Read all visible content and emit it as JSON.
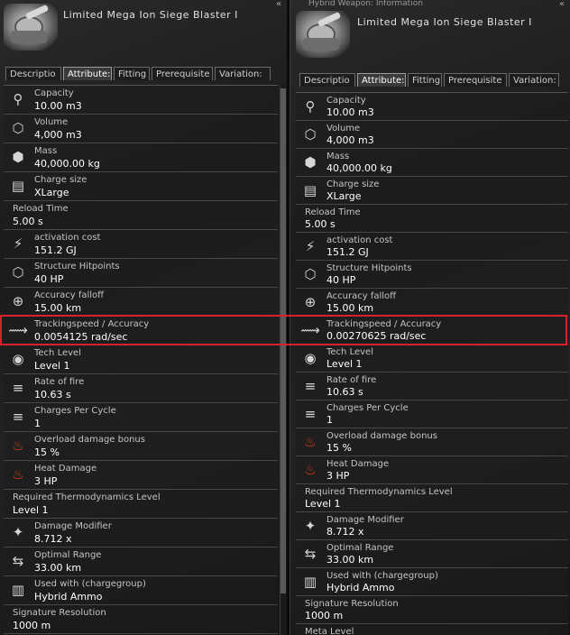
{
  "left": {
    "title": "Limited Mega Ion Siege Blaster I",
    "tabs": [
      {
        "label": "Descriptio"
      },
      {
        "label": "Attribute:"
      },
      {
        "label": "Fitting"
      },
      {
        "label": "Prerequisite"
      },
      {
        "label": "Variation:"
      }
    ],
    "rows": [
      {
        "icon": "capacity-icon",
        "glyph": "⚲",
        "label": "Capacity",
        "value": "10.00 m3"
      },
      {
        "icon": "volume-icon",
        "glyph": "⬡",
        "label": "Volume",
        "value": "4,000 m3"
      },
      {
        "icon": "mass-icon",
        "glyph": "⬢",
        "label": "Mass",
        "value": "40,000.00 kg"
      },
      {
        "icon": "charge-size-icon",
        "glyph": "▤",
        "label": "Charge size",
        "value": "XLarge"
      },
      {
        "icon": "",
        "glyph": "",
        "label": "Reload Time",
        "value": "5.00 s"
      },
      {
        "icon": "activation-cost-icon",
        "glyph": "⚡",
        "label": "activation cost",
        "value": "151.2 GJ"
      },
      {
        "icon": "structure-hitpoints-icon",
        "glyph": "⬡",
        "label": "Structure Hitpoints",
        "value": "40 HP"
      },
      {
        "icon": "accuracy-falloff-icon",
        "glyph": "⊕",
        "label": "Accuracy falloff",
        "value": "15.00 km"
      },
      {
        "icon": "tracking-speed-icon",
        "glyph": "⟿",
        "label": "Trackingspeed / Accuracy",
        "value": "0.0054125 rad/sec"
      },
      {
        "icon": "tech-level-icon",
        "glyph": "◉",
        "label": "Tech Level",
        "value": "Level 1"
      },
      {
        "icon": "rate-of-fire-icon",
        "glyph": "≡",
        "label": "Rate of fire",
        "value": "10.63 s"
      },
      {
        "icon": "charges-per-cycle-icon",
        "glyph": "≡",
        "label": "Charges Per Cycle",
        "value": "1"
      },
      {
        "icon": "overload-damage-icon",
        "glyph": "♨",
        "label": "Overload damage bonus",
        "value": "15 %"
      },
      {
        "icon": "heat-damage-icon",
        "glyph": "♨",
        "label": "Heat Damage",
        "value": "3 HP"
      },
      {
        "icon": "",
        "glyph": "",
        "label": "Required Thermodynamics Level",
        "value": "Level 1"
      },
      {
        "icon": "damage-modifier-icon",
        "glyph": "✦",
        "label": "Damage Modifier",
        "value": "8.712 x"
      },
      {
        "icon": "optimal-range-icon",
        "glyph": "⇆",
        "label": "Optimal Range",
        "value": "33.00 km"
      },
      {
        "icon": "used-with-icon",
        "glyph": "▥",
        "label": "Used with (chargegroup)",
        "value": "Hybrid Ammo"
      },
      {
        "icon": "",
        "glyph": "",
        "label": "Signature Resolution",
        "value": "1000 m"
      }
    ]
  },
  "right": {
    "window_title": "Hybrid Weapon: Information",
    "title": "Limited Mega Ion Siege Blaster I",
    "tabs": [
      {
        "label": "Descriptio"
      },
      {
        "label": "Attribute:"
      },
      {
        "label": "Fitting"
      },
      {
        "label": "Prerequisite"
      },
      {
        "label": "Variation:"
      }
    ],
    "rows": [
      {
        "icon": "capacity-icon",
        "glyph": "⚲",
        "label": "Capacity",
        "value": "10.00 m3"
      },
      {
        "icon": "volume-icon",
        "glyph": "⬡",
        "label": "Volume",
        "value": "4,000 m3"
      },
      {
        "icon": "mass-icon",
        "glyph": "⬢",
        "label": "Mass",
        "value": "40,000.00 kg"
      },
      {
        "icon": "charge-size-icon",
        "glyph": "▤",
        "label": "Charge size",
        "value": "XLarge"
      },
      {
        "icon": "",
        "glyph": "",
        "label": "Reload Time",
        "value": "5.00 s"
      },
      {
        "icon": "activation-cost-icon",
        "glyph": "⚡",
        "label": "activation cost",
        "value": "151.2 GJ"
      },
      {
        "icon": "structure-hitpoints-icon",
        "glyph": "⬡",
        "label": "Structure Hitpoints",
        "value": "40 HP"
      },
      {
        "icon": "accuracy-falloff-icon",
        "glyph": "⊕",
        "label": "Accuracy falloff",
        "value": "15.00 km"
      },
      {
        "icon": "tracking-speed-icon",
        "glyph": "⟿",
        "label": "Trackingspeed / Accuracy",
        "value": "0.00270625 rad/sec"
      },
      {
        "icon": "tech-level-icon",
        "glyph": "◉",
        "label": "Tech Level",
        "value": "Level 1"
      },
      {
        "icon": "rate-of-fire-icon",
        "glyph": "≡",
        "label": "Rate of fire",
        "value": "10.63 s"
      },
      {
        "icon": "charges-per-cycle-icon",
        "glyph": "≡",
        "label": "Charges Per Cycle",
        "value": "1"
      },
      {
        "icon": "overload-damage-icon",
        "glyph": "♨",
        "label": "Overload damage bonus",
        "value": "15 %"
      },
      {
        "icon": "heat-damage-icon",
        "glyph": "♨",
        "label": "Heat Damage",
        "value": "3 HP"
      },
      {
        "icon": "",
        "glyph": "",
        "label": "Required Thermodynamics Level",
        "value": "Level 1"
      },
      {
        "icon": "damage-modifier-icon",
        "glyph": "✦",
        "label": "Damage Modifier",
        "value": "8.712 x"
      },
      {
        "icon": "optimal-range-icon",
        "glyph": "⇆",
        "label": "Optimal Range",
        "value": "33.00 km"
      },
      {
        "icon": "used-with-icon",
        "glyph": "▥",
        "label": "Used with (chargegroup)",
        "value": "Hybrid Ammo"
      },
      {
        "icon": "",
        "glyph": "",
        "label": "Signature Resolution",
        "value": "1000 m"
      },
      {
        "icon": "",
        "glyph": "",
        "label": "Meta Level",
        "value": ""
      }
    ]
  },
  "ui": {
    "collapse_glyph": "«",
    "highlight_color": "#d4232c",
    "heat_icon_color": "#e0401a"
  }
}
